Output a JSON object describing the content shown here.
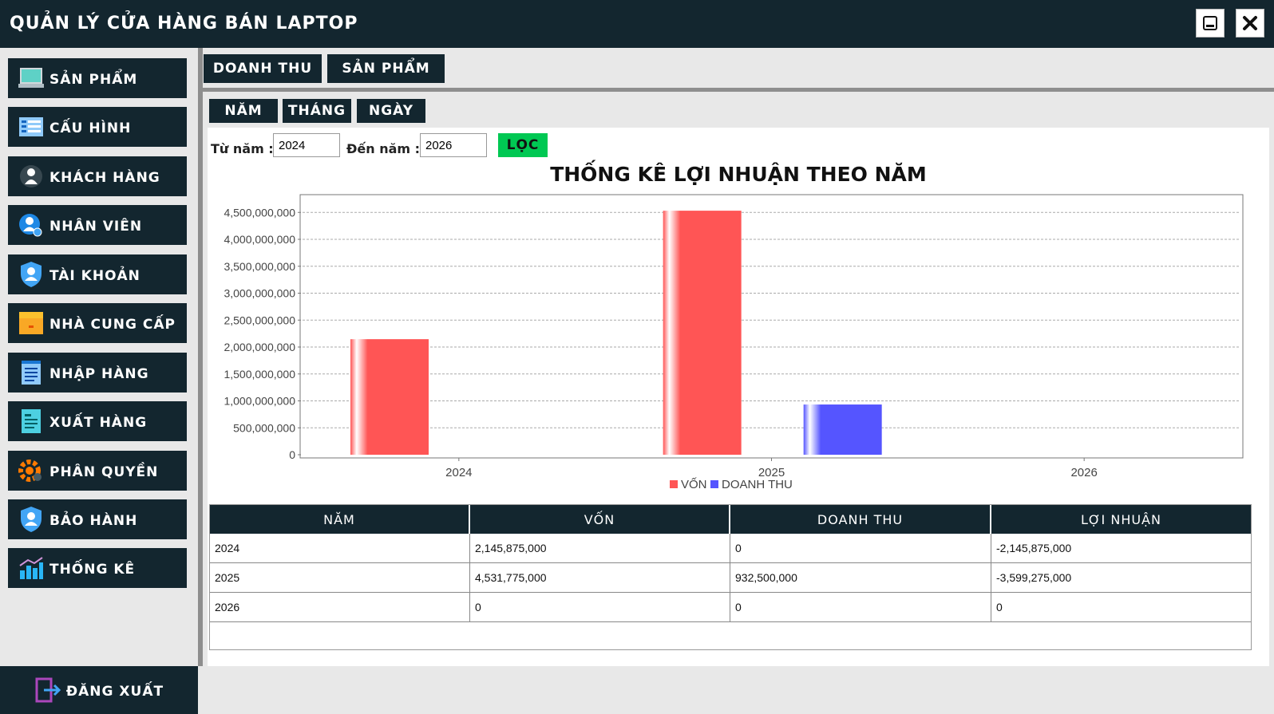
{
  "app": {
    "title": "QUẢN LÝ CỬA HÀNG BÁN LAPTOP"
  },
  "sidebar": {
    "items": [
      {
        "label": "SẢN PHẨM",
        "icon": "laptop-icon"
      },
      {
        "label": "CẤU HÌNH",
        "icon": "spec-list-icon"
      },
      {
        "label": "KHÁCH HÀNG",
        "icon": "customer-icon"
      },
      {
        "label": "NHÂN VIÊN",
        "icon": "employee-icon"
      },
      {
        "label": "TÀI KHOẢN",
        "icon": "account-shield-icon"
      },
      {
        "label": "NHÀ CUNG CẤP",
        "icon": "supplier-box-icon"
      },
      {
        "label": "NHẬP HÀNG",
        "icon": "import-notepad-icon"
      },
      {
        "label": "XUẤT HÀNG",
        "icon": "export-document-icon"
      },
      {
        "label": "PHÂN QUYỀN",
        "icon": "permission-gear-icon"
      },
      {
        "label": "BẢO HÀNH",
        "icon": "warranty-shield-icon"
      },
      {
        "label": "THỐNG KÊ",
        "icon": "statistics-chart-icon"
      }
    ],
    "logout": {
      "label": "ĐĂNG XUẤT",
      "icon": "logout-icon"
    }
  },
  "tabs": {
    "revenue": "DOANH THU",
    "products": "SẢN PHẨM"
  },
  "subtabs": {
    "year": "NĂM",
    "month": "THÁNG",
    "day": "NGÀY"
  },
  "filter": {
    "from_label": "Từ năm :",
    "from_value": "2024",
    "to_label": "Đến năm :",
    "to_value": "2026",
    "button": "LỌC"
  },
  "colors": {
    "dark": "#13262f",
    "von": "#ff5555",
    "doanh_thu": "#5555ff",
    "filter_btn": "#00c853"
  },
  "chart_data": {
    "type": "bar",
    "title": "THỐNG KÊ LỢI NHUẬN THEO NĂM",
    "categories": [
      "2024",
      "2025",
      "2026"
    ],
    "series": [
      {
        "name": "VỐN",
        "values": [
          2145875000,
          4531775000,
          0
        ]
      },
      {
        "name": "DOANH THU",
        "values": [
          0,
          932500000,
          0
        ]
      }
    ],
    "ylim": [
      0,
      4800000000
    ],
    "yticks": [
      "0",
      "500,000,000",
      "1,000,000,000",
      "1,500,000,000",
      "2,000,000,000",
      "2,500,000,000",
      "3,000,000,000",
      "3,500,000,000",
      "4,000,000,000",
      "4,500,000,000"
    ],
    "grid": true,
    "legend": "bottom-center"
  },
  "table": {
    "headers": [
      "NĂM",
      "VỐN",
      "DOANH THU",
      "LỢI NHUẬN"
    ],
    "rows": [
      [
        "2024",
        "2,145,875,000",
        "0",
        "-2,145,875,000"
      ],
      [
        "2025",
        "4,531,775,000",
        "932,500,000",
        "-3,599,275,000"
      ],
      [
        "2026",
        "0",
        "0",
        "0"
      ]
    ]
  }
}
